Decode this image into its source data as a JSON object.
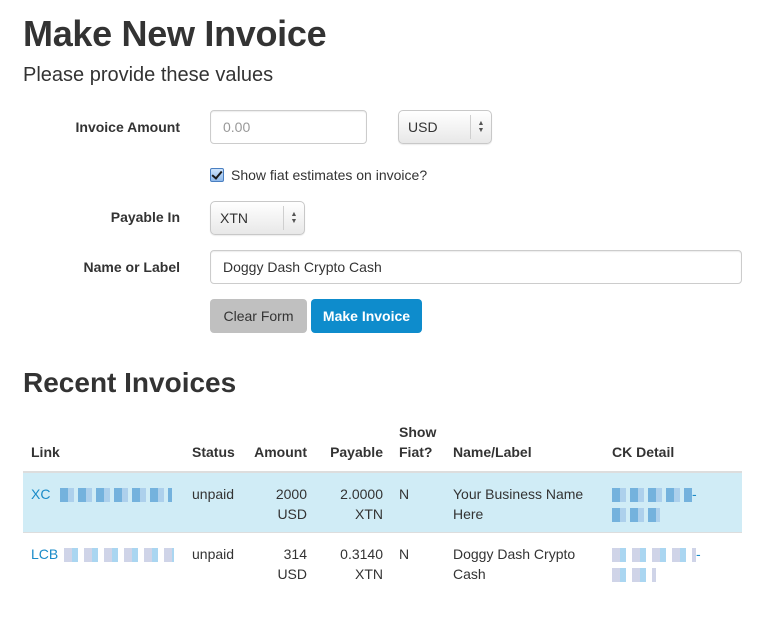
{
  "header": {
    "title": "Make New Invoice",
    "subtitle": "Please provide these values"
  },
  "form": {
    "amount_label": "Invoice Amount",
    "amount_placeholder": "0.00",
    "currency_select": "USD",
    "show_fiat_checkbox": {
      "label": "Show fiat estimates on invoice?",
      "checked": true
    },
    "payable_label": "Payable In",
    "payable_select": "XTN",
    "name_label": "Name or Label",
    "name_value": "Doggy Dash Crypto Cash",
    "clear_button": "Clear Form",
    "make_button": "Make Invoice"
  },
  "recent": {
    "title": "Recent Invoices",
    "columns": [
      "Link",
      "Status",
      "Amount",
      "Payable",
      "Show Fiat?",
      "Name/Label",
      "CK Detail"
    ],
    "column_show_line1": "Show",
    "column_show_line2": "Fiat?",
    "rows": [
      {
        "link_prefix": "XC",
        "status": "unpaid",
        "amount": "2000",
        "amount_currency": "USD",
        "payable": "2.0000",
        "payable_currency": "XTN",
        "show_fiat": "N",
        "name": "Your Business Name Here",
        "ck_detail_suffix": "-",
        "highlighted": true
      },
      {
        "link_prefix": "LCB",
        "status": "unpaid",
        "amount": "314",
        "amount_currency": "USD",
        "payable": "0.3140",
        "payable_currency": "XTN",
        "show_fiat": "N",
        "name": "Doggy Dash Crypto Cash",
        "ck_detail_suffix": "-",
        "highlighted": false
      }
    ]
  },
  "colors": {
    "primary_button": "#0e8ccc",
    "clear_button": "#c0c0c0",
    "row_highlight": "#d0ecf6",
    "link": "#1a8bc8"
  }
}
